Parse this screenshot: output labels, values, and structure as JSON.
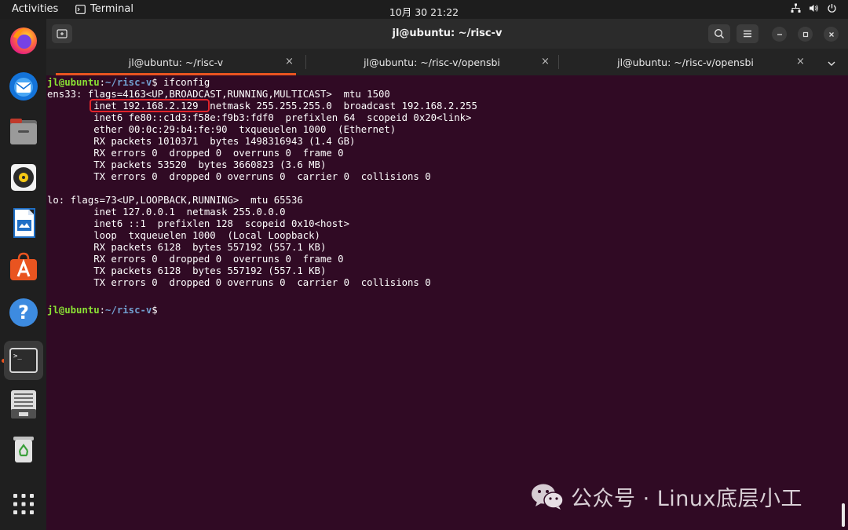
{
  "topbar": {
    "activities": "Activities",
    "app_name": "Terminal",
    "clock": "10月 30  21:22"
  },
  "dock": {
    "items": [
      "firefox-icon",
      "thunderbird-icon",
      "files-icon",
      "rhythmbox-icon",
      "libreoffice-writer-icon",
      "app-center-icon",
      "help-icon",
      "terminal-icon",
      "text-editor-icon",
      "trash-icon",
      "show-apps-icon"
    ]
  },
  "window": {
    "title": "jl@ubuntu: ~/risc-v"
  },
  "tabs": [
    {
      "label": "jl@ubuntu: ~/risc-v",
      "close": "×"
    },
    {
      "label": "jl@ubuntu: ~/risc-v/opensbi",
      "close": "×"
    },
    {
      "label": "jl@ubuntu: ~/risc-v/opensbi",
      "close": "×"
    }
  ],
  "terminal": {
    "prompt_user": "jl@ubuntu",
    "prompt_sep": ":",
    "prompt_path": "~/risc-v",
    "prompt_end": "$ ",
    "command": "ifconfig",
    "lines": [
      "ens33: flags=4163<UP,BROADCAST,RUNNING,MULTICAST>  mtu 1500",
      "        inet 192.168.2.129  netmask 255.255.255.0  broadcast 192.168.2.255",
      "        inet6 fe80::c1d3:f58e:f9b3:fdf0  prefixlen 64  scopeid 0x20<link>",
      "        ether 00:0c:29:b4:fe:90  txqueuelen 1000  (Ethernet)",
      "        RX packets 1010371  bytes 1498316943 (1.4 GB)",
      "        RX errors 0  dropped 0  overruns 0  frame 0",
      "        TX packets 53520  bytes 3660823 (3.6 MB)",
      "        TX errors 0  dropped 0 overruns 0  carrier 0  collisions 0",
      "",
      "lo: flags=73<UP,LOOPBACK,RUNNING>  mtu 65536",
      "        inet 127.0.0.1  netmask 255.0.0.0",
      "        inet6 ::1  prefixlen 128  scopeid 0x10<host>",
      "        loop  txqueuelen 1000  (Local Loopback)",
      "        RX packets 6128  bytes 557192 (557.1 KB)",
      "        RX errors 0  dropped 0  overruns 0  frame 0",
      "        TX packets 6128  bytes 557192 (557.1 KB)",
      "        TX errors 0  dropped 0 overruns 0  carrier 0  collisions 0"
    ]
  },
  "watermark": {
    "text": "公众号 · Linux底层小工"
  },
  "colors": {
    "terminal_bg": "#300a24",
    "accent": "#e95420",
    "prompt_user": "#8ae234",
    "prompt_path": "#729fcf",
    "highlight": "#e0242b"
  }
}
